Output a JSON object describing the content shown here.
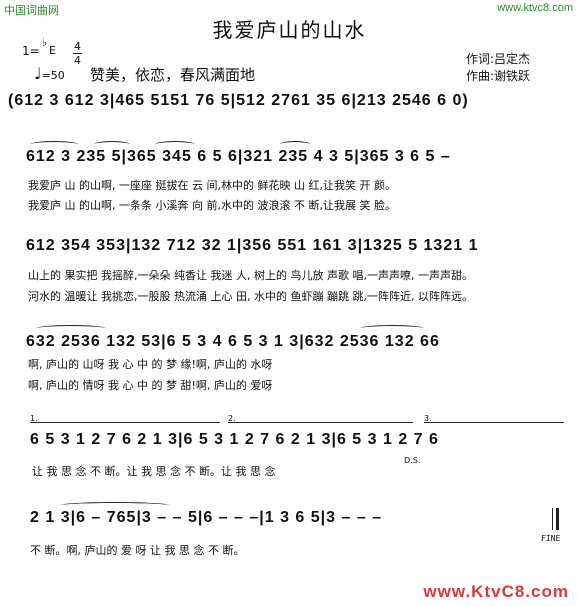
{
  "site": {
    "left": "中国词曲网",
    "right": "www.ktvc8.com"
  },
  "title": "我爱庐山的山水",
  "key": {
    "one": "1=",
    "flat": "♭",
    "e": "E",
    "time_top": "4",
    "time_bottom": "4"
  },
  "tempo": {
    "icon": "quarter-note-icon",
    "value": "=50"
  },
  "intro_lyric": "赞美，依恋，春风满面地",
  "credits": {
    "lyrics": "作词:吕定杰",
    "music": "作曲:谢铁跃"
  },
  "rows": [
    {
      "notes": "(612 3 612 3|465 5151 76 5|512 2761 35 6|213 2546 6 0)",
      "lyrics": []
    },
    {
      "notes": "612 3 235 5|365 345 6 5 6|321 235 4 3 5|365 3 6 5 –",
      "lyrics": [
        "我爱庐 山 的山啊,  一座座 挺拔在 云   间,林中的 鲜花映 山   红,让我笑 开    颜。",
        "我爱庐 山 的山啊,  一条条 小溪奔 向   前,水中的 波浪滚 不   断,让我展 笑    脸。"
      ]
    },
    {
      "notes": "612 354 353|132 712 32 1|356 551 161 3|1325 5 1321 1",
      "lyrics": [
        "山上的 果实把 我摇醉,一朵朵 纯香让 我迷 人, 树上的 鸟儿放  声歌 唱,一声声嘹,  一声声甜。",
        "河水的 温暖让 我挑恋,一股股 热流涌 上心 田,  水中的 鱼虾蹦  蹦跳 跳,一阵阵近,  以阵阵远。"
      ]
    },
    {
      "notes": "632 2536 132 53|6 5 3 4 6 5 3 1 3|632 2536 132 66",
      "lyrics": [
        "啊,         庐山的 山呀 我 心   中     的   梦   缘!啊,         庐山的 水呀",
        "啊,         庐山的 情呀 我 心   中     的   梦   甜!啊,         庐山的 爱呀"
      ]
    },
    {
      "notes": "6 5 3 1 2 7 6 2 1 3|6 5 3 1 2 7 6 2 1 3|6 5 3 1 2 7 6",
      "lyrics": [
        "让 我  思  念  不   断。让 我  思  念  不   断。让 我  思  念"
      ]
    },
    {
      "notes": "2 1 3|6 – 765|3 – – 5|6 – – –|1 3 6 5|3 – – –",
      "lyrics": [
        "不   断。啊,   庐山的  爱     呀 让      我 思 念 不   断。"
      ]
    }
  ],
  "marks": {
    "volta1": "1.",
    "volta2": "2.",
    "volta3": "3.",
    "ds": "D.S.",
    "fine": "FINE"
  },
  "watermark": "www.KtvC8.com"
}
